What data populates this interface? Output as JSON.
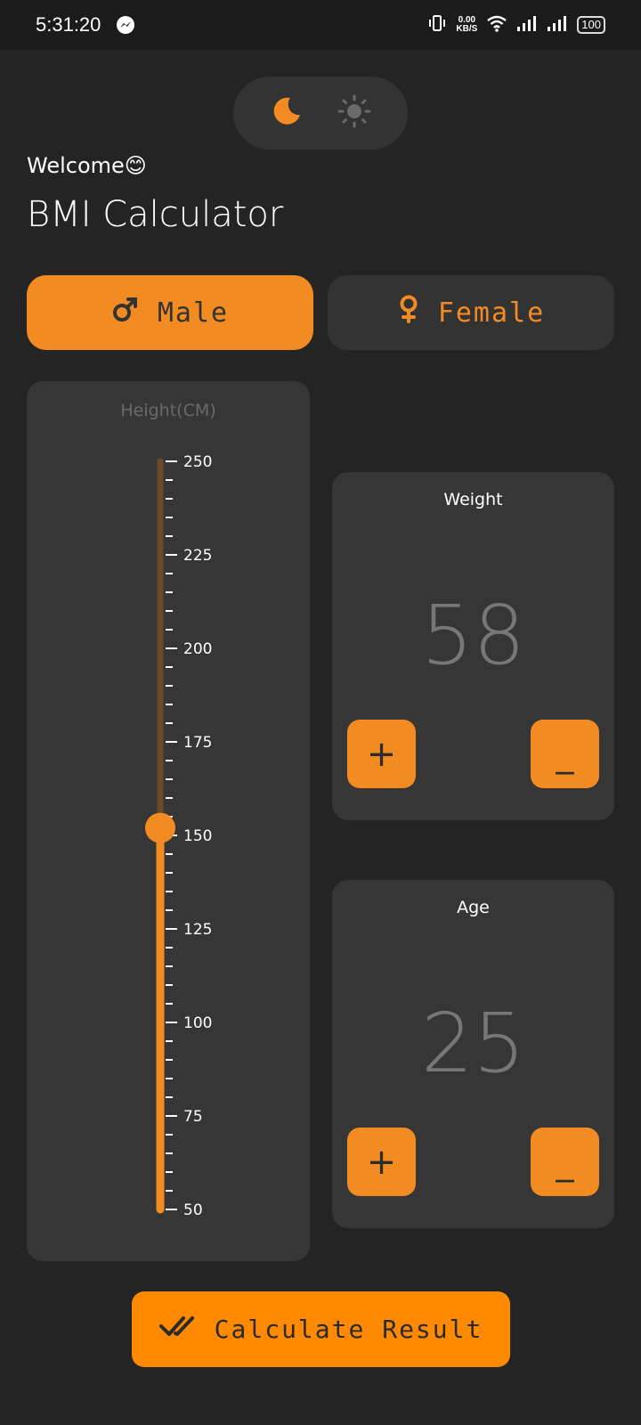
{
  "status_bar": {
    "time": "5:31:20",
    "net_speed_value": "0.00",
    "net_speed_unit": "KB/S",
    "battery": "100"
  },
  "theme_toggle": {
    "active": "dark"
  },
  "header": {
    "welcome": "Welcome😊",
    "title": "BMI Calculator"
  },
  "gender": {
    "male_label": "Male",
    "female_label": "Female",
    "selected": "male"
  },
  "height": {
    "label": "Height(CM)",
    "min": 50,
    "max": 250,
    "value": 152,
    "ticks": [
      "250",
      "225",
      "200",
      "175",
      "150",
      "125",
      "100",
      "75",
      "50"
    ]
  },
  "weight": {
    "label": "Weight",
    "value": "58",
    "plus": "+",
    "minus": "_"
  },
  "age": {
    "label": "Age",
    "value": "25",
    "plus": "+",
    "minus": "_"
  },
  "calculate_button": {
    "label": "Calculate Result"
  },
  "colors": {
    "accent": "#f28c22",
    "background": "#242424",
    "card": "#363636",
    "slider_track_inactive": "#6b4a2a"
  }
}
